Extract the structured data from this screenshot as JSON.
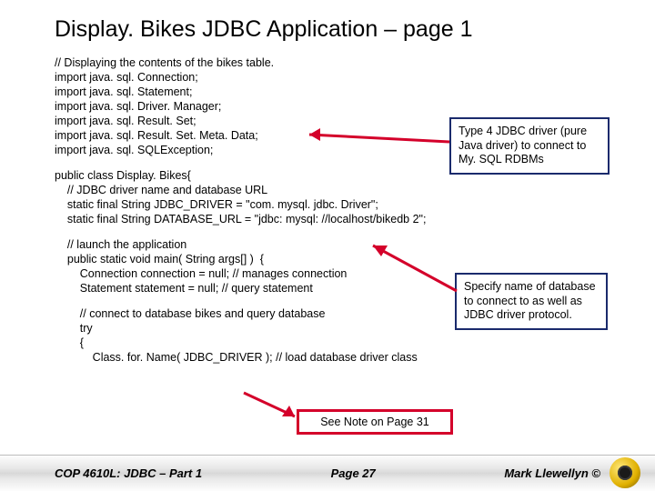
{
  "title": "Display. Bikes JDBC Application – page 1",
  "code": {
    "l1": "// Displaying the contents of the bikes table.",
    "l2": "import java. sql. Connection;",
    "l3": "import java. sql. Statement;",
    "l4": "import java. sql. Driver. Manager;",
    "l5": "import java. sql. Result. Set;",
    "l6": "import java. sql. Result. Set. Meta. Data;",
    "l7": "import java. sql. SQLException;",
    "l8": "public class Display. Bikes{",
    "l9": "    // JDBC driver name and database URL",
    "l10": "    static final String JDBC_DRIVER = \"com. mysql. jdbc. Driver\";",
    "l11": "    static final String DATABASE_URL = \"jdbc: mysql: //localhost/bikedb 2\";",
    "l12": "    // launch the application",
    "l13": "    public static void main( String args[] )  {",
    "l14": "        Connection connection = null; // manages connection",
    "l15": "        Statement statement = null; // query statement",
    "l16": "        // connect to database bikes and query database",
    "l17": "        try",
    "l18": "        {",
    "l19": "            Class. for. Name( JDBC_DRIVER ); // load database driver class"
  },
  "callout1": "Type 4 JDBC driver  (pure Java driver) to connect to My. SQL RDBMs",
  "callout2": "Specify name of database to connect to as well as JDBC driver protocol.",
  "note": "See Note on Page 31",
  "footer": {
    "left": "COP 4610L: JDBC – Part 1",
    "center": "Page 27",
    "right": "Mark Llewellyn ©"
  }
}
